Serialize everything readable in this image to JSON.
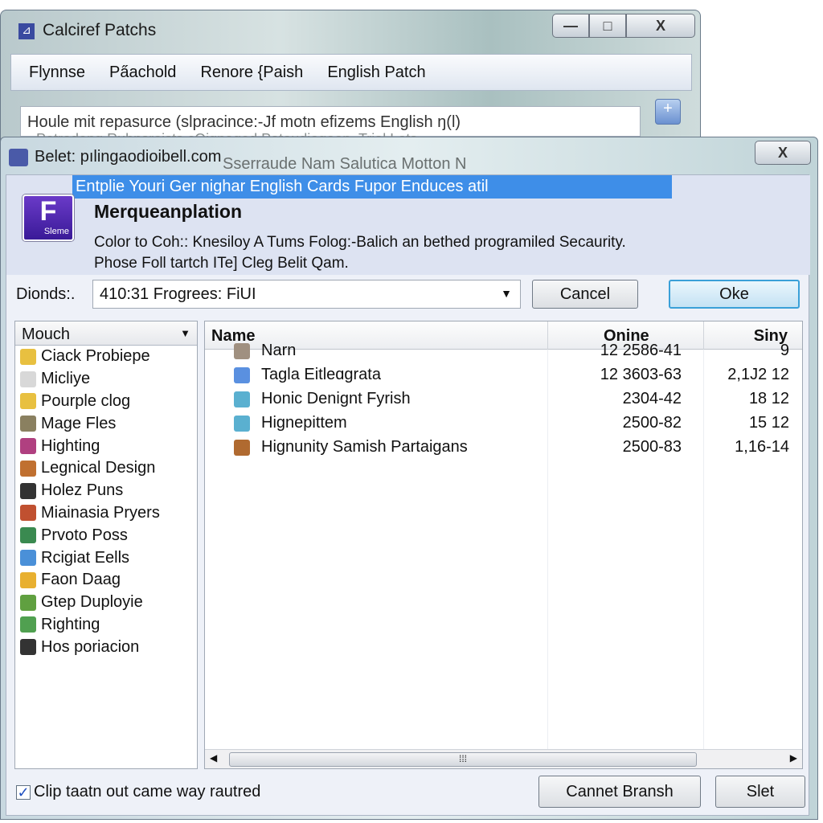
{
  "back_window": {
    "title": "Calciref Patchs",
    "menu": [
      "Flynnse",
      "Pa̋achold",
      "Renore {Paish",
      "English Patch"
    ],
    "search_value": "Houle mit repasurce (slpracince:-Jf motn efizems English ŋ(l)",
    "faded_row1": "Petrodeng Rubnsroists cOignaged   Patoudiogoon.   Trial Lots",
    "faded_row2": "Sserraude   Nam Salutica   Motton N"
  },
  "dialog": {
    "title": "Belet: pılingaodioibell.com",
    "highlight": "Entplie Youri Ger nighar English Cards Fupor Enduces atil",
    "app_icon_label": "Sleme",
    "heading": "Merqueanplation",
    "desc1": "Color to Coh:: Knesiloy A Tums Folog:-Balich an bethed programiled Secaurity.",
    "desc2": "Phose Foll tartch ITe] Cleg Belit Qam.",
    "field_label": "Dionds:.",
    "combo_value": "410:31 Frogrees: FiUI",
    "cancel": "Cancel",
    "ok": "Oke",
    "folder_combo": "Mouch",
    "sidebar": [
      {
        "label": "Ciack Probiepe",
        "icon": "folder-icon",
        "color": "#e8c040"
      },
      {
        "label": "Micliye",
        "icon": "document-icon",
        "color": "#d8d8d8"
      },
      {
        "label": "Pourple clog",
        "icon": "folder-icon",
        "color": "#e8c040"
      },
      {
        "label": "Mage Fles",
        "icon": "image-icon",
        "color": "#8a8060"
      },
      {
        "label": "Highting",
        "icon": "people-icon",
        "color": "#b04080"
      },
      {
        "label": "Legnical Design",
        "icon": "monitor-icon",
        "color": "#c07030"
      },
      {
        "label": "Holez Puns",
        "icon": "clock-icon",
        "color": "#333333"
      },
      {
        "label": "Miainasia Pryers",
        "icon": "disc-icon",
        "color": "#c05030"
      },
      {
        "label": "Prvoto Poss",
        "icon": "globe-icon",
        "color": "#3a8a50"
      },
      {
        "label": "Rcigiat Eells",
        "icon": "gear-icon",
        "color": "#4a90d8"
      },
      {
        "label": "Faon Daag",
        "icon": "star-icon",
        "color": "#e8b030"
      },
      {
        "label": "Gtep Duployie",
        "icon": "pot-icon",
        "color": "#60a040"
      },
      {
        "label": "Righting",
        "icon": "landscape-icon",
        "color": "#50a050"
      },
      {
        "label": "Hos poriacion",
        "icon": "network-icon",
        "color": "#333333"
      }
    ],
    "columns": [
      "Name",
      "Onine",
      "Siny"
    ],
    "files": [
      {
        "name": "Narn",
        "onine": "12 2586-41",
        "siny": "9",
        "icon": "shield-icon",
        "color": "#a09080"
      },
      {
        "name": "Tagla Eitleɑgrata",
        "onine": "12 3603-63",
        "siny": "2,1J2 12",
        "icon": "document-icon",
        "color": "#5a90e0"
      },
      {
        "name": "Honic Denignt Fyrish",
        "onine": "2304-42",
        "siny": "18 12",
        "icon": "folder-icon",
        "color": "#5ab0d0"
      },
      {
        "name": "Hignepittem",
        "onine": "2500-82",
        "siny": "15 12",
        "icon": "folder-icon",
        "color": "#5ab0d0"
      },
      {
        "name": "Hignunity Samish Partaigans",
        "onine": "2500-83",
        "siny": "1,16-14",
        "icon": "cookie-icon",
        "color": "#b06a30"
      }
    ],
    "checkbox_label": "Clip taatn out came way rautred",
    "checkbox_checked": true,
    "btn_secondary": "Cannet Bransh",
    "btn_primary": "Slet"
  }
}
